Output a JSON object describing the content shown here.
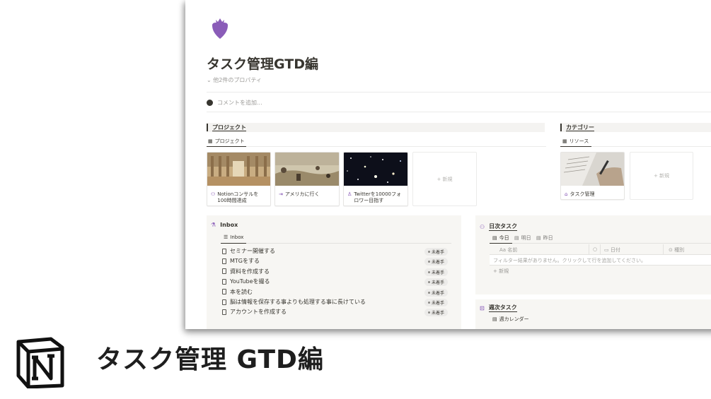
{
  "page": {
    "title": "タスク管理GTD編",
    "properties_toggle": "他2件のプロパティ",
    "comment_placeholder": "コメントを追加..."
  },
  "projects": {
    "heading": "プロジェクト",
    "view_tab": "プロジェクト",
    "cards": [
      {
        "label": "Notionコンサルを100時間達成",
        "icon": "handshake-icon"
      },
      {
        "label": "アメリカに行く",
        "icon": "arrow-icon"
      },
      {
        "label": "Twitterを10000フォロワー目指す",
        "icon": "rocket-icon"
      }
    ],
    "new_label": "+ 新規"
  },
  "categories": {
    "heading": "カテゴリー",
    "view_tab": "リソース",
    "cards": [
      {
        "label": "タスク管理",
        "icon": "home-icon"
      }
    ],
    "new_label": "+ 新規"
  },
  "inbox": {
    "title": "Inbox",
    "view_tab": "Inbox",
    "items": [
      {
        "label": "セミナー開催する",
        "status": "未着手"
      },
      {
        "label": "MTGをする",
        "status": "未着手"
      },
      {
        "label": "資料を作成する",
        "status": "未着手"
      },
      {
        "label": "YouTubeを撮る",
        "status": "未着手"
      },
      {
        "label": "本を読む",
        "status": "未着手"
      },
      {
        "label": "脳は情報を保存する事よりも処理する事に長けている",
        "status": "未着手"
      },
      {
        "label": "アカウントを作成する",
        "status": "未着手"
      }
    ]
  },
  "daily": {
    "title": "日次タスク",
    "tabs": [
      "今日",
      "明日",
      "昨日"
    ],
    "columns": [
      "Aa 名前",
      "",
      "日付",
      "種別"
    ],
    "empty_message": "フィルター結果がありません。クリックして行を追加してください。",
    "new_label": "+ 新規"
  },
  "weekly": {
    "title": "週次タスク",
    "tab": "週カレンダー"
  },
  "caption": {
    "title": "タスク管理 GTD編"
  },
  "colors": {
    "accent_purple": "#8a5cb8",
    "text": "#37352f",
    "muted": "#9b9a97",
    "panel_bg": "#f7f6f3"
  }
}
